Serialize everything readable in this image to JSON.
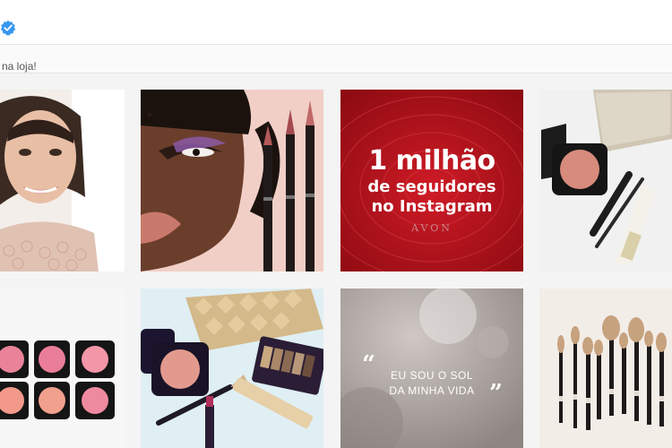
{
  "profile": {
    "verified_icon": "verified-badge-icon",
    "bio_fragment": "na loja!"
  },
  "posts": [
    {
      "name": "post-portrait-smiling",
      "kind": "photo"
    },
    {
      "name": "post-eyeliner-look",
      "kind": "photo"
    },
    {
      "name": "post-milestone",
      "kind": "graphic",
      "line1": "1 milhão",
      "line2": "de seguidores",
      "line3": "no Instagram",
      "brand": "AVON"
    },
    {
      "name": "post-blush-products",
      "kind": "photo"
    },
    {
      "name": "post-blush-compacts",
      "kind": "photo"
    },
    {
      "name": "post-makeup-flatlay",
      "kind": "photo"
    },
    {
      "name": "post-quote",
      "kind": "graphic",
      "open_quote": "“",
      "line1": "EU SOU O SOL",
      "line2": "DA MINHA VIDA",
      "close_quote": "”"
    },
    {
      "name": "post-brushes",
      "kind": "photo"
    }
  ],
  "colors": {
    "accent_verified": "#3897f0",
    "promo_red": "#b5121b"
  }
}
